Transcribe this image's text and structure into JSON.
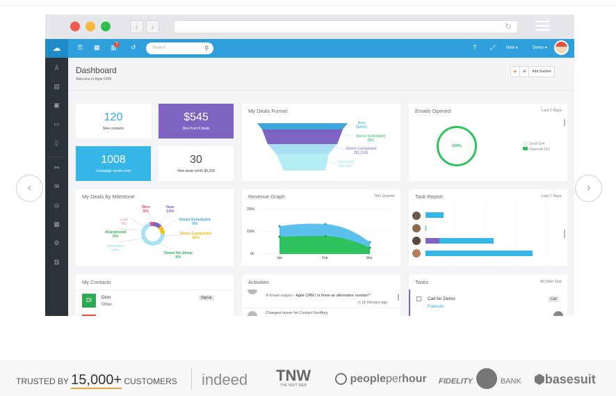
{
  "browser": {
    "reload_icon": "reload-icon",
    "menu_icon": "hamburger-icon"
  },
  "colors": {
    "brand": "#2f9fdb",
    "sidebar": "#2c3239",
    "purple": "#7e57c2",
    "cyan": "#35b8e8",
    "green": "#2ec25f"
  },
  "appbar": {
    "search_placeholder": "Search",
    "notification_count": "7",
    "new_label": "New",
    "user_label": "Demo"
  },
  "dashboard": {
    "title": "Dashboard",
    "subtitle": "Welcome to Agile CRM",
    "add_dashlet": "Add Dashlet"
  },
  "stats": [
    {
      "value": "120",
      "label": "New contacts"
    },
    {
      "value": "$545",
      "label": "Won from 9 deals"
    },
    {
      "value": "1008",
      "label": "Campaign emails sent"
    },
    {
      "value": "30",
      "label": "New deals worth $5,318"
    }
  ],
  "funnel": {
    "title": "My Deals Funnel",
    "stages": [
      {
        "name": "New",
        "value": "($400)"
      },
      {
        "name": "Demo Scheduled",
        "value": "($0)"
      },
      {
        "name": "Demo Completed",
        "value": "($1,200)"
      },
      {
        "name": "Interested",
        "value": "($2,300)"
      }
    ]
  },
  "emails": {
    "title": "Emails Opened",
    "range": "Last 2 Days",
    "percent": "100%",
    "sent_label": "Sent:104",
    "opened_label": "Opened:112"
  },
  "milestone": {
    "title": "My Deals by Milestone",
    "slices": [
      {
        "name": "Won",
        "pct": "8%"
      },
      {
        "name": "New",
        "pct": "14%"
      },
      {
        "name": "Lost",
        "pct": "0%"
      },
      {
        "name": "Demo Scheduled",
        "pct": "0%"
      },
      {
        "name": "Abandoned",
        "pct": "0%"
      },
      {
        "name": "Demo Completed",
        "pct": "32%"
      },
      {
        "name": "Interested",
        "pct": "54%"
      },
      {
        "name": "Demo No-Show",
        "pct": "0%"
      }
    ]
  },
  "revenue": {
    "title": "Revenue Graph",
    "range": "This Quarter",
    "yticks": [
      "200k",
      "100k",
      "0k"
    ],
    "xticks": [
      "Jan",
      "Feb",
      "Mar"
    ]
  },
  "tasks_report": {
    "title": "Task Report",
    "range": "Last 7 Days"
  },
  "contacts": {
    "title": "My Contacts",
    "items": [
      {
        "initials": "DI",
        "name": "Dion",
        "sub": "Other,",
        "tag": "Signup"
      }
    ]
  },
  "activities": {
    "title": "Activities",
    "items": [
      {
        "prefix": "Email subject - ",
        "text": "Agile CRM | Is there an alternative number?",
        "time": "11 minutes ago"
      },
      {
        "text": "Changed owner for Contact Geoffrey"
      }
    ]
  },
  "tasks": {
    "title": "Tasks",
    "range": "All Over Due",
    "items": [
      {
        "name": "Call for Demo",
        "tag": "Call",
        "owner": "Francois"
      }
    ]
  },
  "trusted": {
    "prefix": "TRUSTED BY",
    "count": "15,000+",
    "suffix": "CUSTOMERS"
  },
  "logos": {
    "indeed": "indeed",
    "tnw": "TNW",
    "tnw_sub": "THE NEXT WEB",
    "people": "people",
    "per": "per",
    "hour": "hour",
    "fidelity": "FIDELITY",
    "bank": "BANK",
    "basesuit": "basesuit"
  },
  "carousel": {
    "prev": "‹",
    "next": "›"
  }
}
